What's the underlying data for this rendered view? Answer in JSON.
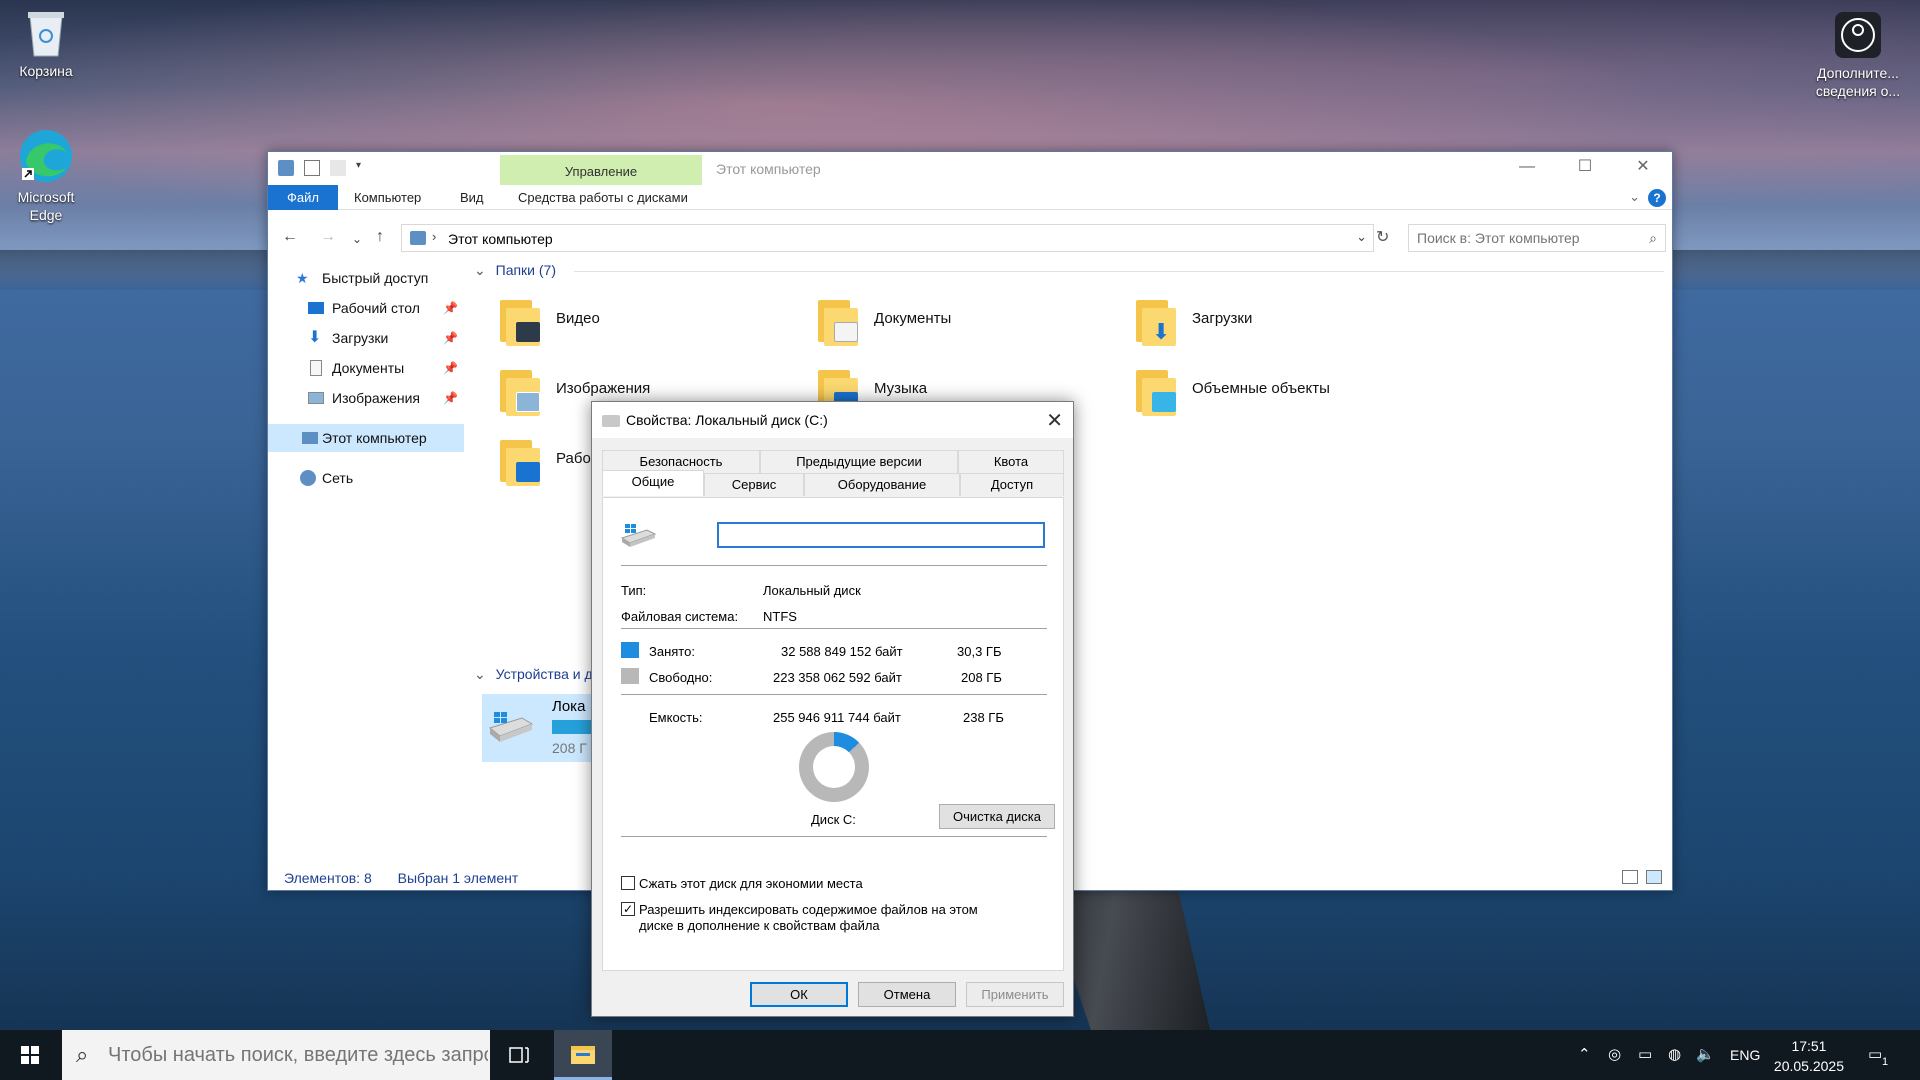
{
  "desktop": {
    "icons": [
      {
        "label": "Корзина"
      },
      {
        "label": "Microsoft Edge"
      },
      {
        "label": "Дополните... сведения о..."
      }
    ]
  },
  "explorer": {
    "title": "Этот компьютер",
    "manage_tab": "Управление",
    "ribbon_tabs": [
      "Файл",
      "Компьютер",
      "Вид",
      "Средства работы с дисками"
    ],
    "address": "Этот компьютер",
    "search_placeholder": "Поиск в: Этот компьютер",
    "nav": {
      "quick_access": "Быстрый доступ",
      "items": [
        {
          "label": "Рабочий стол"
        },
        {
          "label": "Загрузки"
        },
        {
          "label": "Документы"
        },
        {
          "label": "Изображения"
        }
      ],
      "this_pc": "Этот компьютер",
      "network": "Сеть"
    },
    "folders_group": "Папки (7)",
    "folders": [
      {
        "label": "Видео"
      },
      {
        "label": "Документы"
      },
      {
        "label": "Загрузки"
      },
      {
        "label": "Изображения"
      },
      {
        "label": "Музыка"
      },
      {
        "label": "Объемные объекты"
      },
      {
        "label": "Рабо"
      }
    ],
    "devices_group": "Устройства и д",
    "drive": {
      "label": "Лока",
      "free": "208 Г"
    },
    "status": {
      "items": "Элементов: 8",
      "selected": "Выбран 1 элемент"
    }
  },
  "dialog": {
    "title": "Свойства: Локальный диск (C:)",
    "tabs_top": [
      "Безопасность",
      "Предыдущие версии",
      "Квота"
    ],
    "tabs_bottom": [
      "Общие",
      "Сервис",
      "Оборудование",
      "Доступ"
    ],
    "name_value": "",
    "type_label": "Тип:",
    "type_value": "Локальный диск",
    "fs_label": "Файловая система:",
    "fs_value": "NTFS",
    "used": {
      "label": "Занято:",
      "bytes": "32 588 849 152 байт",
      "size": "30,3 ГБ",
      "color": "#1e8de0"
    },
    "free": {
      "label": "Свободно:",
      "bytes": "223 358 062 592 байт",
      "size": "208 ГБ",
      "color": "#b8b8b8"
    },
    "capacity": {
      "label": "Емкость:",
      "bytes": "255 946 911 744 байт",
      "size": "238 ГБ"
    },
    "used_fraction": 0.127,
    "disk_label": "Диск C:",
    "cleanup_button": "Очистка диска",
    "compress_label": "Сжать этот диск для экономии места",
    "compress_checked": false,
    "index_label_1": "Разрешить индексировать содержимое файлов на этом",
    "index_label_2": "диске в дополнение к свойствам файла",
    "index_checked": true,
    "ok": "ОК",
    "cancel": "Отмена",
    "apply": "Применить"
  },
  "taskbar": {
    "search_placeholder": "Чтобы начать поиск, введите здесь запрос",
    "lang": "ENG",
    "time": "17:51",
    "date": "20.05.2025",
    "notifications": "1"
  }
}
